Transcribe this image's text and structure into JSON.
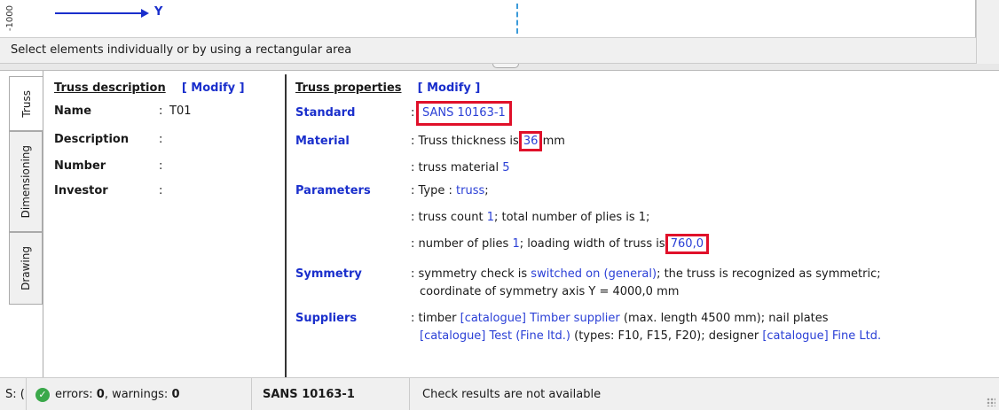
{
  "canvas": {
    "y_axis_tick": "-1000",
    "x_axis_name": "Y"
  },
  "hint": "Select elements individually or by  using a rectangular area",
  "tabs": [
    "Truss",
    "Dimensioning",
    "Drawing"
  ],
  "truss_description": {
    "heading": "Truss description",
    "modify": "[ Modify ]",
    "fields": [
      {
        "label": "Name",
        "colon": ":",
        "value": "T01"
      },
      {
        "label": "Description",
        "colon": ":",
        "value": ""
      },
      {
        "label": "Number",
        "colon": ":",
        "value": ""
      },
      {
        "label": "Investor",
        "colon": ":",
        "value": ""
      }
    ]
  },
  "truss_properties": {
    "heading": "Truss properties",
    "modify": "[ Modify ]",
    "standard_label": "Standard",
    "standard_value": "SANS 10163-1",
    "material_label": "Material",
    "material_line1_pre": ": Truss thickness is",
    "material_thickness": "36",
    "material_line1_post": "mm",
    "material_line2_pre": ": truss material",
    "material_line2_val": "5",
    "parameters_label": "Parameters",
    "param_line1_pre": ":  Type :",
    "param_line1_val": "truss",
    "param_line1_post": ";",
    "param_line2_pre": ": truss count",
    "param_line2_val": "1",
    "param_line2_post": "; total number of plies is 1;",
    "param_line3_pre": ": number of plies",
    "param_line3_val": "1",
    "param_line3_mid": "; loading width of truss is",
    "param_line3_width": "760,0",
    "symmetry_label": "Symmetry",
    "sym_line1_pre": ": symmetry check is",
    "sym_line1_val": "switched on (general)",
    "sym_line1_post": "; the truss is recognized as symmetric;",
    "sym_line2": "coordinate of symmetry axis  Y = 4000,0 mm",
    "suppliers_label": "Suppliers",
    "sup_line1_pre": ": timber",
    "sup_line1_link": "[catalogue] Timber supplier",
    "sup_line1_post": "(max. length 4500 mm); nail plates",
    "sup_line2_link1": "[catalogue] Test (Fine ltd.)",
    "sup_line2_mid": "(types: F10, F15, F20); designer",
    "sup_line2_link2": "[catalogue] Fine Ltd."
  },
  "status": {
    "cell0": "S: (",
    "errors_label": "errors:",
    "errors": "0",
    "warnings_label": ", warnings:",
    "warnings": "0",
    "standard": "SANS 10163-1",
    "check": "Check results are not available"
  }
}
